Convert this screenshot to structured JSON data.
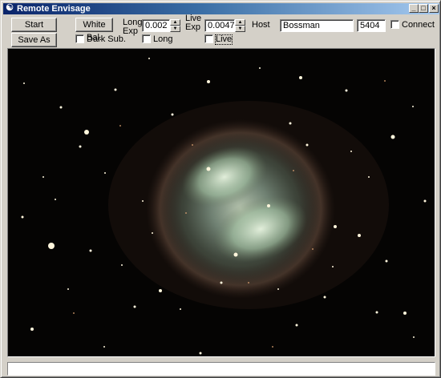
{
  "window": {
    "title": "Remote Envisage",
    "title_icon": "app-icon",
    "caption_buttons": [
      "minimize",
      "maximize",
      "close"
    ]
  },
  "toolbar": {
    "start_label": "Start",
    "save_as_label": "Save As",
    "white_bal_label": "White Bal.",
    "dark_sub_label": "Dark Sub.",
    "dark_sub_checked": false,
    "long_exp_label_1": "Long",
    "long_exp_label_2": "Exp",
    "long_exp_value": "0.002",
    "long_label": "Long",
    "long_checked": false,
    "live_exp_label_1": "Live",
    "live_exp_label_2": "Exp",
    "live_exp_value": "0.0047",
    "live_label": "Live",
    "live_checked": false,
    "host_label": "Host",
    "host_value": "Bossman",
    "port_value": "5404",
    "connect_label": "Connect",
    "connect_checked": false
  },
  "image": {
    "subject": "dumbbell-nebula-starfield",
    "background_color": "#050403"
  },
  "status": {
    "text": ""
  }
}
